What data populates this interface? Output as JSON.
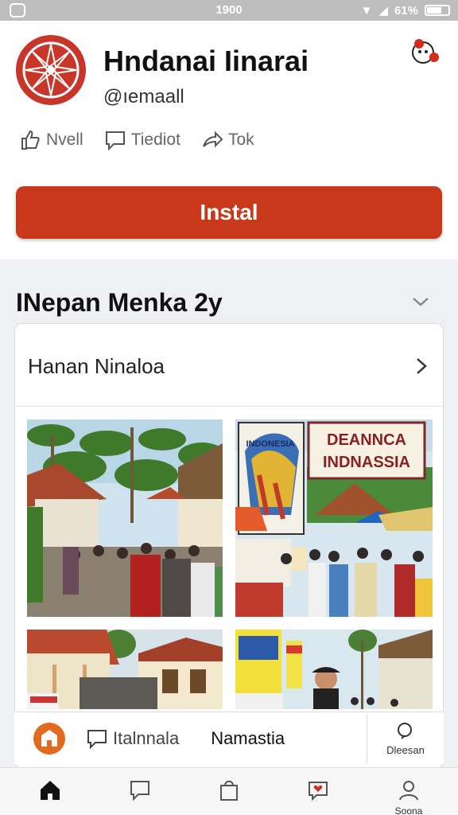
{
  "status_bar": {
    "time": "1900",
    "battery": "61%"
  },
  "profile": {
    "name": "Hndanai Iinarai",
    "handle": "@ıemaall",
    "actions": [
      {
        "icon": "thumbs-up-icon",
        "label": "Nvell"
      },
      {
        "icon": "comment-icon",
        "label": "Tiediot"
      },
      {
        "icon": "share-icon",
        "label": "Tok"
      }
    ],
    "install_label": "Instal"
  },
  "section": {
    "title": "INepan Menka 2y",
    "row_label": "Hanan Ninaloa"
  },
  "photos": {
    "sign_left": "INDONESIA",
    "sign_right_line1": "DEANNCA",
    "sign_right_line2": "INDNASSIA"
  },
  "bottom_card": {
    "item_label": "Italnnala",
    "middle_label": "Namastia",
    "search_label": "Dleesan"
  },
  "tab_bar": {
    "items": [
      {
        "icon": "home-icon",
        "label": ""
      },
      {
        "icon": "chat-icon",
        "label": ""
      },
      {
        "icon": "bag-icon",
        "label": ""
      },
      {
        "icon": "heart-icon",
        "label": ""
      },
      {
        "icon": "profile-icon",
        "label": "Soona"
      }
    ]
  },
  "colors": {
    "accent": "#c8391b",
    "logo": "#c8362a"
  }
}
